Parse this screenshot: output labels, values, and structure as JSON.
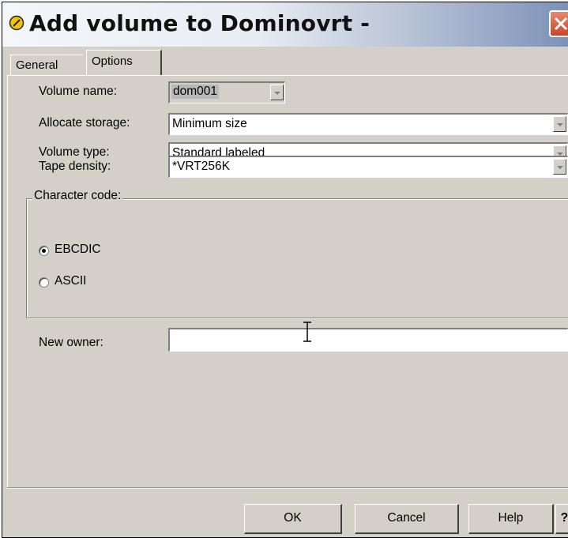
{
  "window": {
    "title": "Add volume to Dominovrt  -",
    "icon": "dialog-app-icon",
    "close_icon": "close-icon"
  },
  "tabs": [
    {
      "label": "General",
      "selected": false
    },
    {
      "label": "Options",
      "selected": true
    }
  ],
  "form": {
    "volume_name": {
      "label": "Volume name:",
      "value": "dom001"
    },
    "allocate_storage": {
      "label": "Allocate storage:",
      "value": "Minimum size"
    },
    "volume_type": {
      "label": "Volume type:",
      "value": "Standard labeled"
    },
    "tape_density": {
      "label": "Tape density:",
      "value": "*VRT256K"
    },
    "character_code": {
      "legend": "Character code:",
      "options": [
        {
          "label": "EBCDIC",
          "selected": true
        },
        {
          "label": "ASCII",
          "selected": false
        }
      ]
    },
    "new_owner": {
      "label": "New owner:",
      "value": ""
    }
  },
  "buttons": {
    "ok": "OK",
    "cancel": "Cancel",
    "help": "Help",
    "whats_this": "?"
  },
  "colors": {
    "dialog_face": "#d4d0c8",
    "close_button": "#c8452b",
    "title_gradient_end": "#7d91b8"
  }
}
